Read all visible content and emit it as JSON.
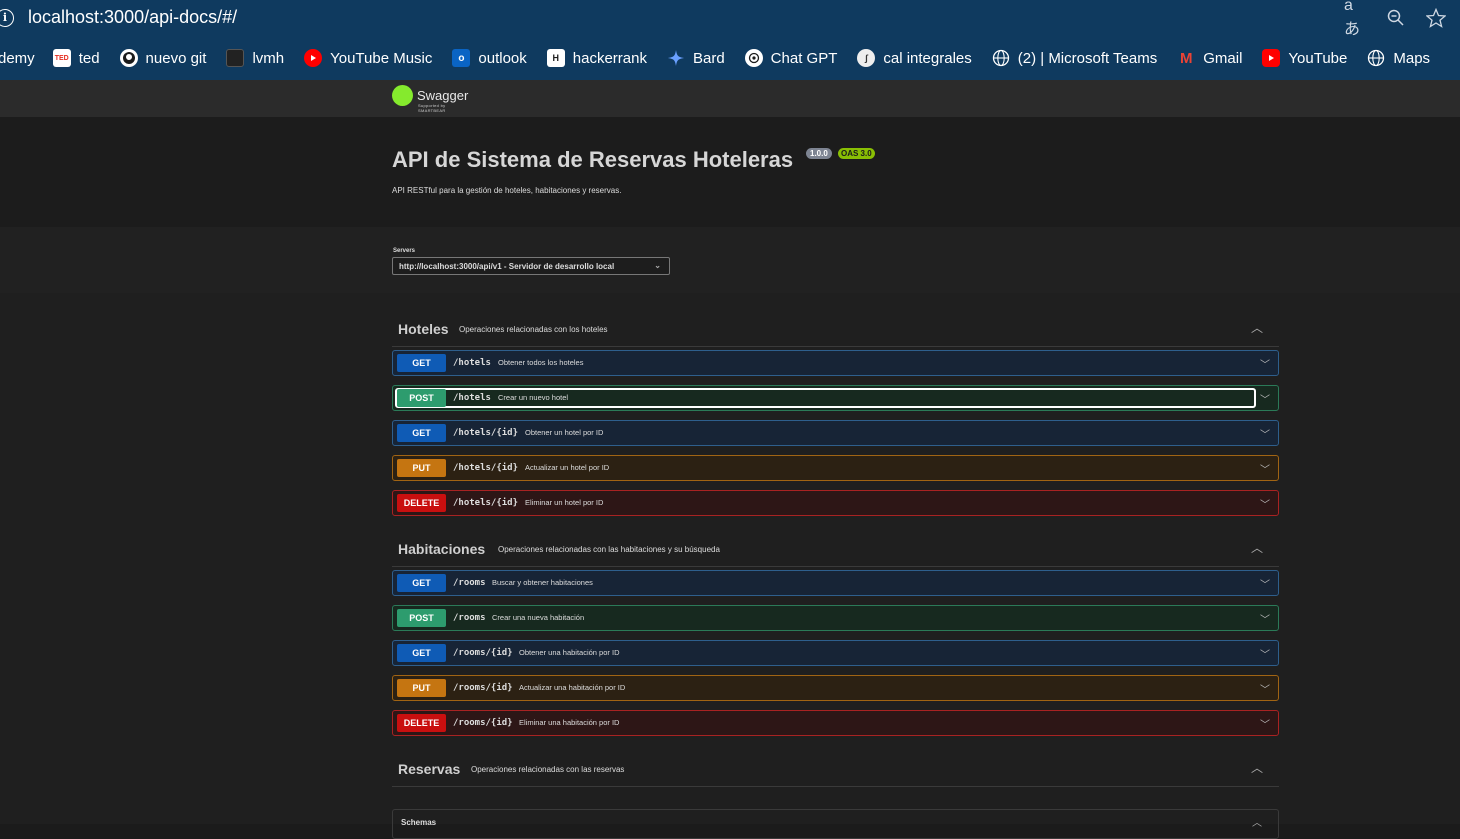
{
  "browser": {
    "url": "localhost:3000/api-docs/#/",
    "bookmarks": [
      {
        "label": "demy",
        "icon": "udemy-icon"
      },
      {
        "label": "ted",
        "icon": "ted-icon",
        "icon_text": "TED"
      },
      {
        "label": "nuevo git",
        "icon": "github-icon"
      },
      {
        "label": "lvmh",
        "icon": "lvmh-icon"
      },
      {
        "label": "YouTube Music",
        "icon": "youtube-music-icon"
      },
      {
        "label": "outlook",
        "icon": "outlook-icon"
      },
      {
        "label": "hackerrank",
        "icon": "hackerrank-icon",
        "icon_text": "H"
      },
      {
        "label": "Bard",
        "icon": "bard-icon"
      },
      {
        "label": "Chat GPT",
        "icon": "chatgpt-icon"
      },
      {
        "label": "cal integrales",
        "icon": "calculator-icon"
      },
      {
        "label": "(2) | Microsoft Teams",
        "icon": "globe-icon"
      },
      {
        "label": "Gmail",
        "icon": "gmail-icon",
        "icon_text": "M"
      },
      {
        "label": "YouTube",
        "icon": "youtube-icon"
      },
      {
        "label": "Maps",
        "icon": "globe-icon"
      }
    ]
  },
  "swagger": {
    "logo_text": "Swagger",
    "logo_sub": "Supported by SMARTBEAR",
    "title": "API de Sistema de Reservas Hoteleras",
    "version": "1.0.0",
    "oas": "OAS 3.0",
    "description": "API RESTful para la gestión de hoteles, habitaciones y reservas.",
    "servers_label": "Servers",
    "server_selected": "http://localhost:3000/api/v1 - Servidor de desarrollo local"
  },
  "tags": [
    {
      "name": "Hoteles",
      "description": "Operaciones relacionadas con los hoteles",
      "operations": [
        {
          "method": "GET",
          "path": "/hotels",
          "summary": "Obtener todos los hoteles"
        },
        {
          "method": "POST",
          "path": "/hotels",
          "summary": "Crear un nuevo hotel"
        },
        {
          "method": "GET",
          "path": "/hotels/{id}",
          "summary": "Obtener un hotel por ID"
        },
        {
          "method": "PUT",
          "path": "/hotels/{id}",
          "summary": "Actualizar un hotel por ID"
        },
        {
          "method": "DELETE",
          "path": "/hotels/{id}",
          "summary": "Eliminar un hotel por ID"
        }
      ]
    },
    {
      "name": "Habitaciones",
      "description": "Operaciones relacionadas con las habitaciones y su búsqueda",
      "operations": [
        {
          "method": "GET",
          "path": "/rooms",
          "summary": "Buscar y obtener habitaciones"
        },
        {
          "method": "POST",
          "path": "/rooms",
          "summary": "Crear una nueva habitación"
        },
        {
          "method": "GET",
          "path": "/rooms/{id}",
          "summary": "Obtener una habitación por ID"
        },
        {
          "method": "PUT",
          "path": "/rooms/{id}",
          "summary": "Actualizar una habitación por ID"
        },
        {
          "method": "DELETE",
          "path": "/rooms/{id}",
          "summary": "Eliminar una habitación por ID"
        }
      ]
    },
    {
      "name": "Reservas",
      "description": "Operaciones relacionadas con las reservas",
      "operations": []
    }
  ],
  "schemas_label": "Schemas",
  "colors": {
    "get": "#0f5bb5",
    "post": "#2d9c6e",
    "put": "#c57511",
    "delete": "#c90f0f",
    "swagger_green": "#85ea2d"
  }
}
